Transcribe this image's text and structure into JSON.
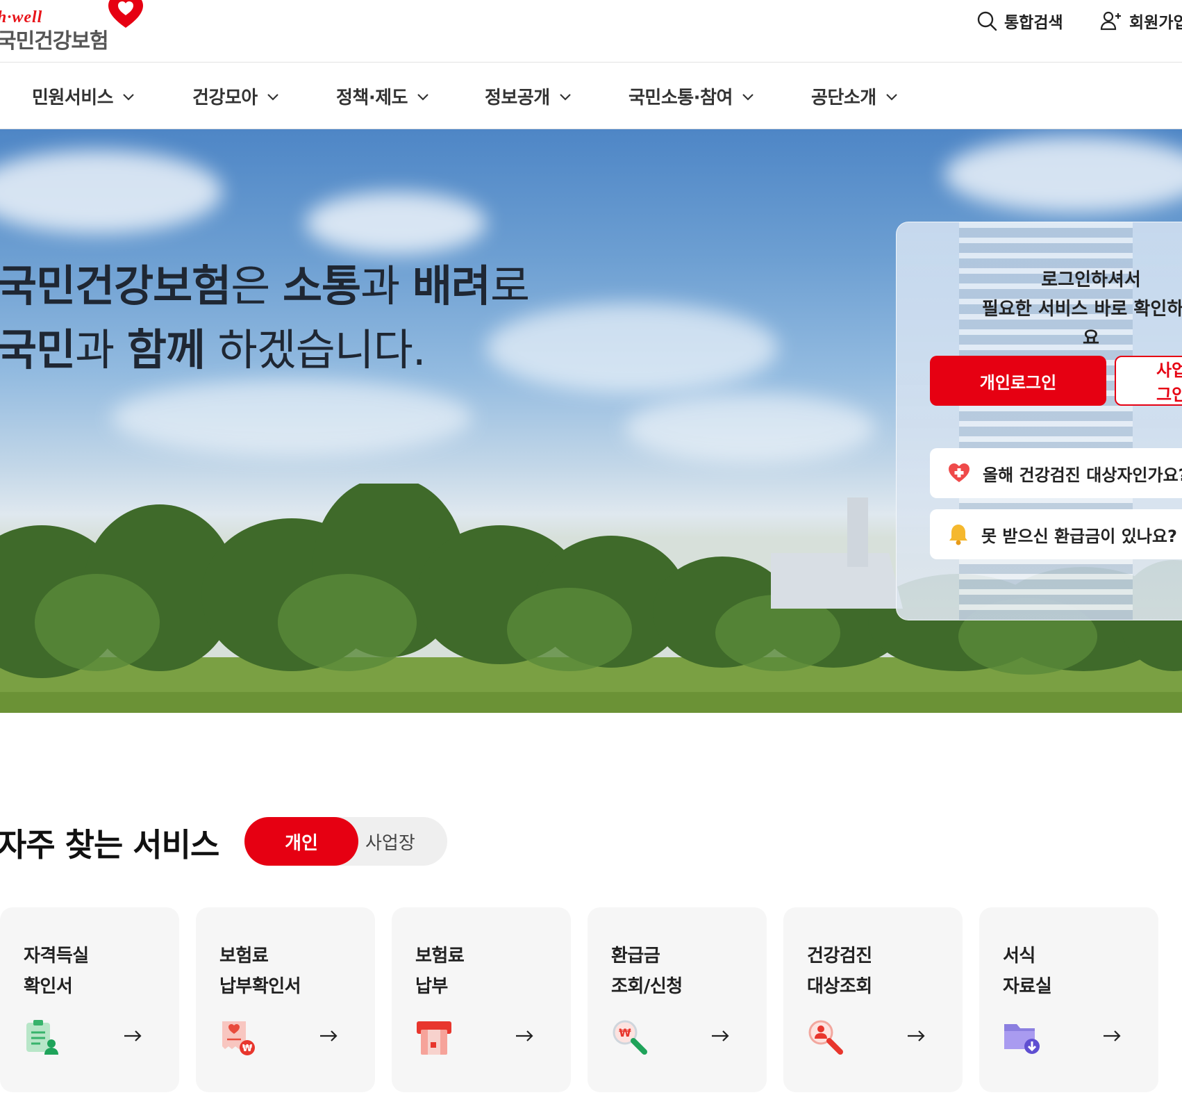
{
  "header": {
    "logo_sub": "h·well",
    "logo_main": "국민건강보험",
    "search_label": "통합검색",
    "join_label": "회원가입"
  },
  "gnb": {
    "items": [
      {
        "label": "민원서비스"
      },
      {
        "label": "건강모아"
      },
      {
        "label": "정책·제도"
      },
      {
        "label": "정보공개"
      },
      {
        "label": "국민소통·참여"
      },
      {
        "label": "공단소개"
      }
    ]
  },
  "hero": {
    "line1": {
      "a": "국민건강보험",
      "b": "은 ",
      "c": "소통",
      "d": "과 ",
      "e": "배려",
      "f": "로"
    },
    "line2": {
      "a": "국민",
      "b": "과 ",
      "c": "함께",
      "d": " 하겠습니다."
    },
    "login": {
      "message": "로그인하셔서\n필요한 서비스 바로 확인하세요",
      "personal_button": "개인로그인",
      "business_button": "사업장로그인",
      "quick1": "올해 건강검진 대상자인가요?",
      "quick2": "못 받으신 환급금이 있나요?"
    }
  },
  "favorites": {
    "title": "자주 찾는 서비스",
    "toggle_on": "개인",
    "toggle_off": "사업장",
    "cards": [
      {
        "label": "자격득실\n확인서",
        "icon": "certificate-user-icon"
      },
      {
        "label": "보험료\n납부확인서",
        "icon": "receipt-won-icon"
      },
      {
        "label": "보험료\n납부",
        "icon": "payment-machine-icon"
      },
      {
        "label": "환급금\n조회/신청",
        "icon": "search-won-icon"
      },
      {
        "label": "건강검진\n대상조회",
        "icon": "search-person-icon"
      },
      {
        "label": "서식\n자료실",
        "icon": "folder-download-icon"
      }
    ]
  },
  "colors": {
    "accent": "#e60012",
    "card_bg": "#f6f6f6"
  }
}
